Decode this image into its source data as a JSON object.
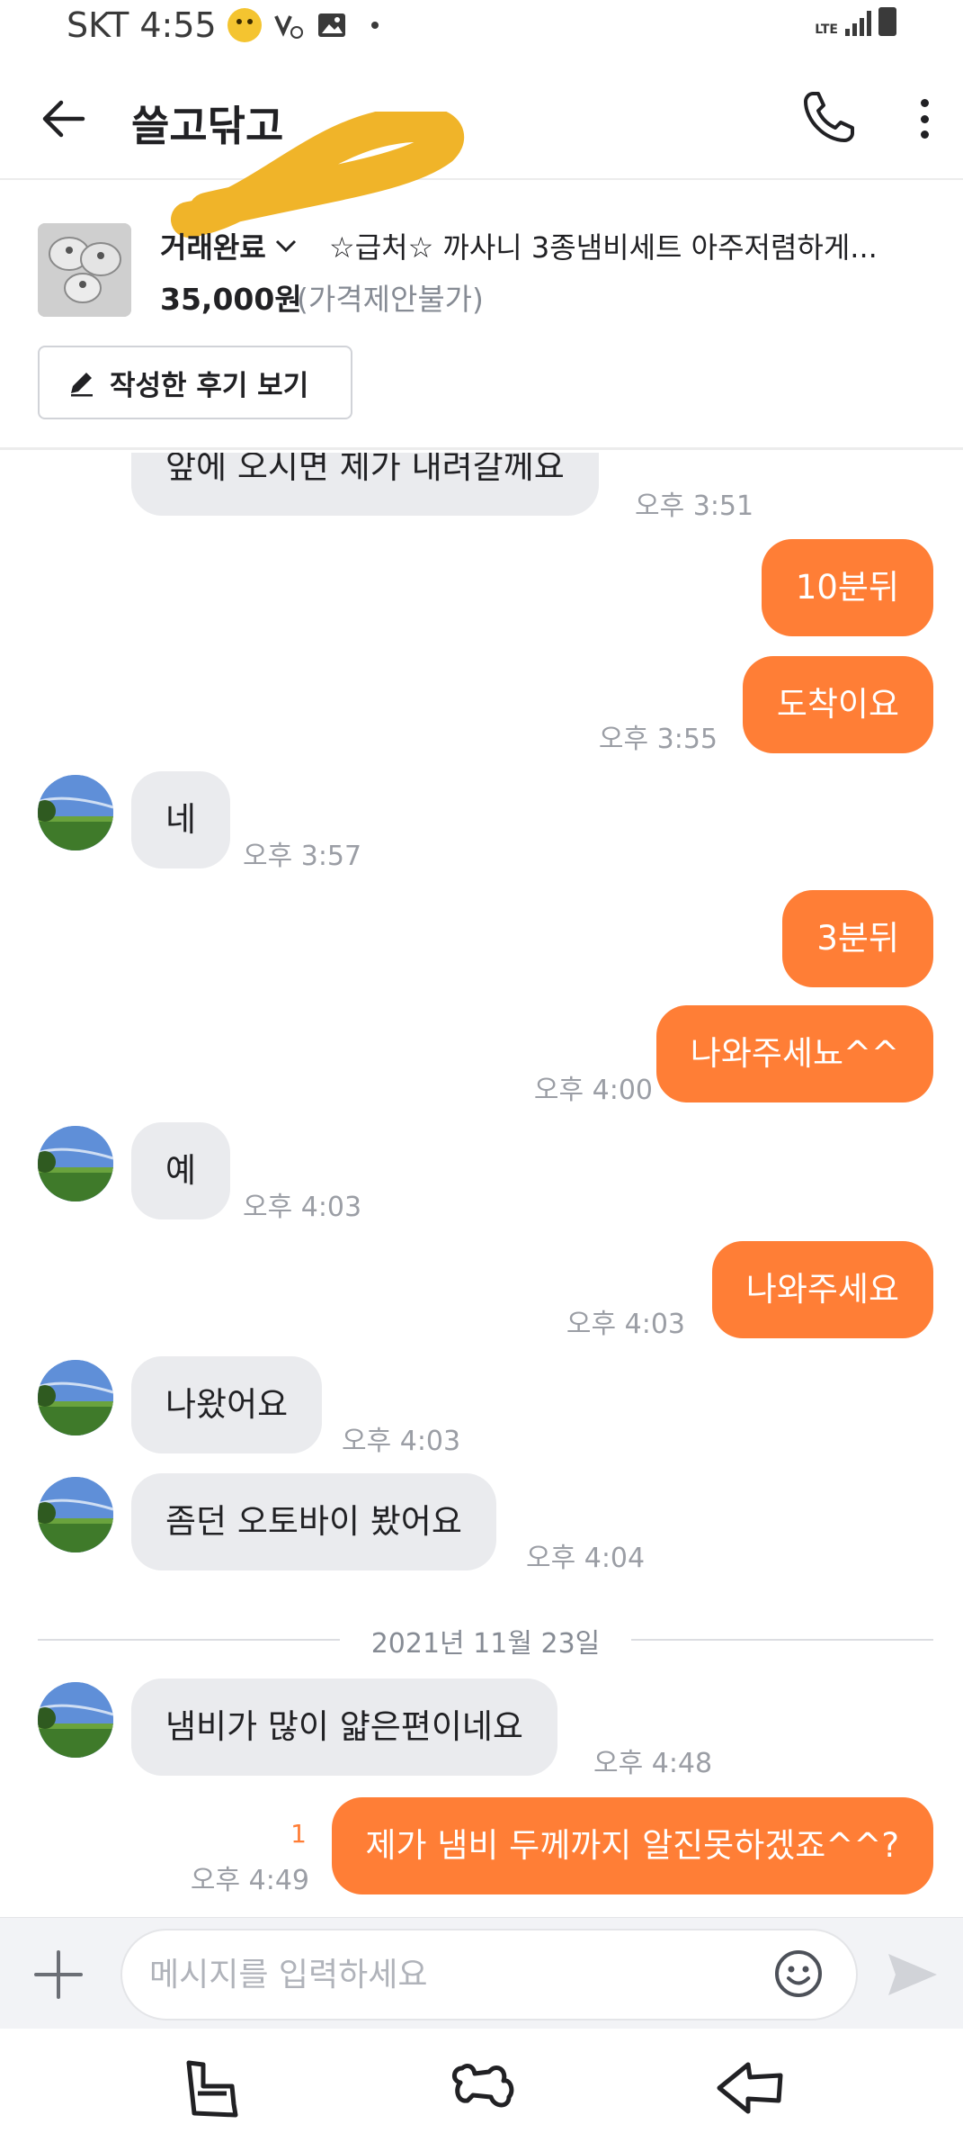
{
  "status_bar": {
    "carrier_time": "SKT 4:55",
    "network": "LTE"
  },
  "header": {
    "title": "쓸고닦고"
  },
  "product": {
    "status": "거래완료",
    "title": "☆급처☆ 까사니 3종냄비세트 아주저렴하게...",
    "price": "35,000원",
    "price_note": "(가격제안불가)",
    "review_button": "작성한 후기 보기"
  },
  "messages": [
    {
      "text": "앞에 오시면 제가 내려갈께요",
      "time": "오후 3:51"
    },
    {
      "text": "10분뒤",
      "time": ""
    },
    {
      "text": "도착이요",
      "time": "오후 3:55"
    },
    {
      "text": "네",
      "time": "오후 3:57"
    },
    {
      "text": "3분뒤",
      "time": ""
    },
    {
      "text": "나와주세뇨^^",
      "time": "오후 4:00"
    },
    {
      "text": "예",
      "time": "오후 4:03"
    },
    {
      "text": "나와주세요",
      "time": "오후 4:03"
    },
    {
      "text": "나왔어요",
      "time": "오후 4:03"
    },
    {
      "text": "좀던 오토바이 봤어요",
      "time": "오후 4:04"
    },
    {
      "text": "냄비가 많이 얇은편이네요",
      "time": "오후 4:48"
    },
    {
      "text": "제가 냄비 두께까지 알진못하겠죠^^?",
      "time": "오후 4:49",
      "unread": "1"
    }
  ],
  "date_separator": "2021년 11월 23일",
  "input": {
    "placeholder": "메시지를 입력하세요"
  },
  "colors": {
    "accent": "#ff7e36",
    "incoming_bubble": "#eaebee",
    "redaction": "#f0b429"
  }
}
